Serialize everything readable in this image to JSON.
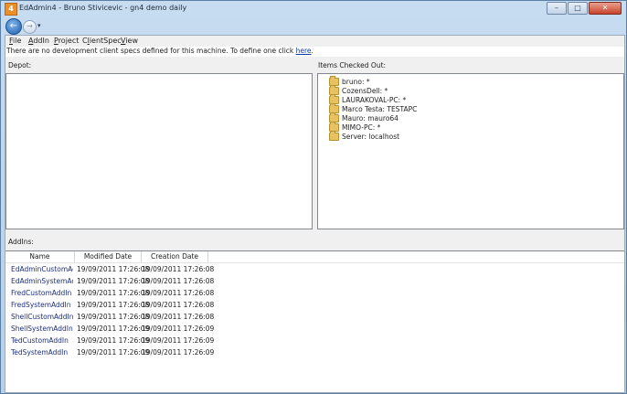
{
  "window": {
    "app_icon_glyph": "4",
    "title": "EdAdmin4 - Bruno Stivicevic - gn4 demo daily",
    "caption_buttons": {
      "minimize": "–",
      "maximize": "□",
      "close": "✕"
    }
  },
  "nav": {
    "back_glyph": "←",
    "forward_glyph": "→",
    "dropdown_glyph": "▾"
  },
  "menu": [
    {
      "label": "File",
      "accel": "F",
      "rest": "ile"
    },
    {
      "label": "AddIn",
      "accel": "A",
      "rest": "ddIn"
    },
    {
      "label": "Project",
      "accel": "P",
      "rest": "roject"
    },
    {
      "label": "ClientSpec",
      "pre": "C",
      "accel": "l",
      "rest": "ientSpec"
    },
    {
      "label": "View",
      "accel": "V",
      "rest": "iew"
    }
  ],
  "notice": {
    "text": "There are no development client specs defined for this machine. To define one click ",
    "link": "here",
    "tail": "."
  },
  "depot": {
    "label": "Depot:"
  },
  "checked_out": {
    "label": "Items Checked Out:",
    "items": [
      "bruno: *",
      "CozensDell: *",
      "LAURAKOVAL-PC: *",
      "Marco Testa: TESTAPC",
      "Mauro: mauro64",
      "MIMO-PC: *",
      "Server: localhost"
    ]
  },
  "addins": {
    "label": "AddIns:",
    "columns": [
      "Name",
      "Modified Date",
      "Creation Date"
    ],
    "rows": [
      [
        "EdAdminCustomAdd",
        "19/09/2011 17:26:08",
        "19/09/2011 17:26:08"
      ],
      [
        "EdAdminSystemAdd",
        "19/09/2011 17:26:08",
        "19/09/2011 17:26:08"
      ],
      [
        "FredCustomAddIn",
        "19/09/2011 17:26:08",
        "19/09/2011 17:26:08"
      ],
      [
        "FredSystemAddIn",
        "19/09/2011 17:26:08",
        "19/09/2011 17:26:08"
      ],
      [
        "ShellCustomAddIn",
        "19/09/2011 17:26:08",
        "19/09/2011 17:26:08"
      ],
      [
        "ShellSystemAddIn",
        "19/09/2011 17:26:09",
        "19/09/2011 17:26:09"
      ],
      [
        "TedCustomAddIn",
        "19/09/2011 17:26:09",
        "19/09/2011 17:26:09"
      ],
      [
        "TedSystemAddIn",
        "19/09/2011 17:26:09",
        "19/09/2011 17:26:09"
      ]
    ]
  }
}
